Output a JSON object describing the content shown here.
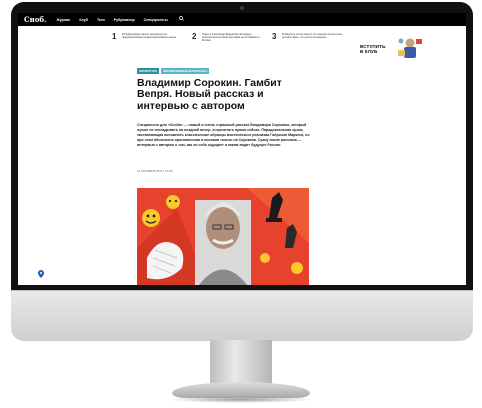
{
  "header": {
    "logo": "Сноб.",
    "nav": [
      "Журнал",
      "Клуб",
      "Теги",
      "Рубрикатор",
      "Спецпроекты"
    ],
    "search_icon": "search-icon"
  },
  "top_news": [
    {
      "num": "1",
      "text": "В Подмосковье нашли сверхбыструю предприимчивую конкретизированную мышь"
    },
    {
      "num": "2",
      "text": "Гарри и Александр Ванденбергвитейдер: Константинопольская выставка на Остоженке в Москве"
    },
    {
      "num": "3",
      "text": "В Марселе после многих лет разлуки встретились для выставки, что длится на неделю"
    }
  ],
  "promo": {
    "text": "ВСТУПИТЬ\nВ КЛУБ"
  },
  "article": {
    "tags": [
      "ЛИТЕРАТУРА",
      "ЭКСКЛЮЗИВНЫЕ МАТЕРИАЛЫ"
    ],
    "title": "Владимир Сорокин. Гамбит Вепря. Новый рассказ и интервью с автором",
    "lead": "Специально для «Сноба» — новый и очень страшный рассказ Владимира Сорокина, который лучше не откладывать на поздний вечер, а прочитать прямо сейчас. Парадоксальная проза, заставляющая вспомнить классические образцы мистического реализма Габриэля Маркеса, но при этом абсолютно оригинальная и похожая только на Сорокина. Сразу после рассказа — интервью с автором о том, как он себя ощущает и каким видит будущее России",
    "date": "11 ОКТЯБРЯ 2021 / 15:04"
  },
  "colors": {
    "accent": "#2b8fa3",
    "hero_bg": "#e6422d",
    "header_bg": "#000000"
  }
}
